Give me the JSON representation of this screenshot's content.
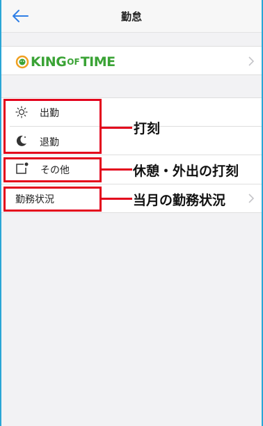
{
  "header": {
    "title": "勤怠"
  },
  "logo": {
    "text_left": "KING",
    "text_of": "OF",
    "text_right": "TIME"
  },
  "menu": {
    "clock_in": "出勤",
    "clock_out": "退勤",
    "other": "その他",
    "work_status": "勤務状況"
  },
  "annotations": {
    "clock": "打刻",
    "break": "休憩・外出の打刻",
    "monthly": "当月の勤務状況"
  },
  "colors": {
    "brand_green": "#3aa335",
    "annotation_red": "#e3001b",
    "back_blue": "#2f7fe6"
  },
  "icons": {
    "back": "back-arrow-icon",
    "clock_in": "sun-icon",
    "clock_out": "moon-icon",
    "other": "square-dot-icon",
    "disclosure": "chevron-right-icon"
  }
}
